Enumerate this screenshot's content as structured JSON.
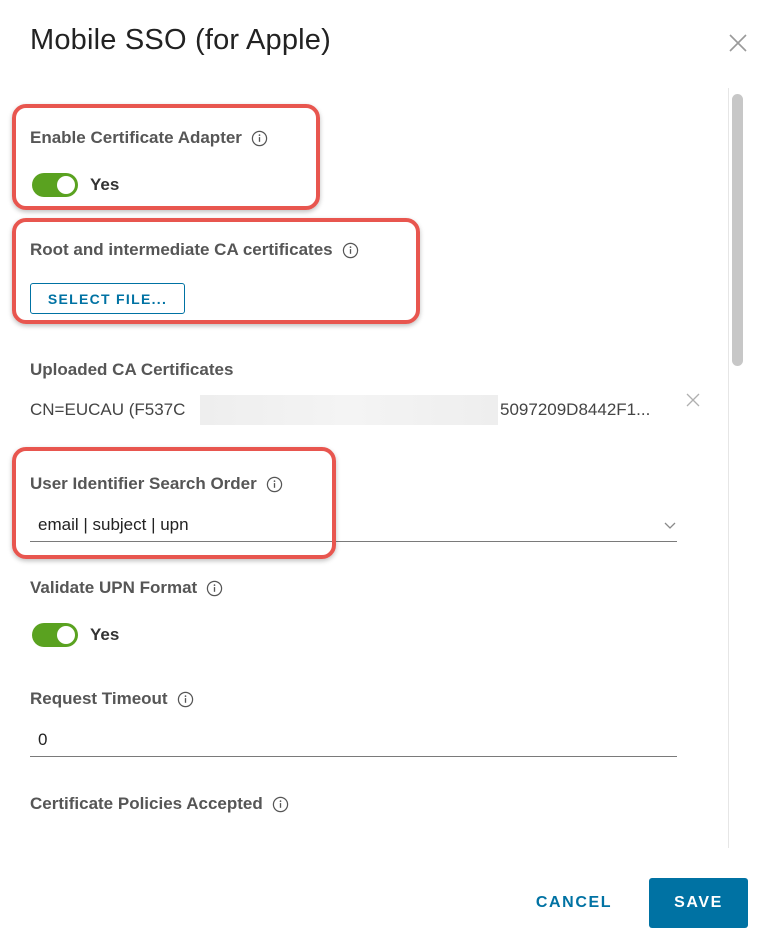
{
  "dialog": {
    "title": "Mobile SSO (for Apple)"
  },
  "fields": {
    "enable_cert_adapter": {
      "label": "Enable Certificate Adapter",
      "toggle_text": "Yes",
      "enabled": true
    },
    "root_ca": {
      "label": "Root and intermediate CA certificates",
      "button_label": "SELECT FILE..."
    },
    "uploaded_ca": {
      "label": "Uploaded CA Certificates",
      "value_start": "CN=EUCAU (F537C",
      "value_end": "5097209D8442F1..."
    },
    "user_identifier": {
      "label": "User Identifier Search Order",
      "value": "email | subject | upn"
    },
    "validate_upn": {
      "label": "Validate UPN Format",
      "toggle_text": "Yes",
      "enabled": true
    },
    "request_timeout": {
      "label": "Request Timeout",
      "value": "0"
    },
    "cert_policies": {
      "label": "Certificate Policies Accepted"
    }
  },
  "footer": {
    "cancel_label": "CANCEL",
    "save_label": "SAVE"
  },
  "colors": {
    "accent": "#0072a3",
    "toggle_on": "#5aa220",
    "highlight": "#e8564f"
  },
  "icons": [
    "close-icon",
    "info-icon",
    "chevron-down-icon",
    "remove-icon"
  ]
}
